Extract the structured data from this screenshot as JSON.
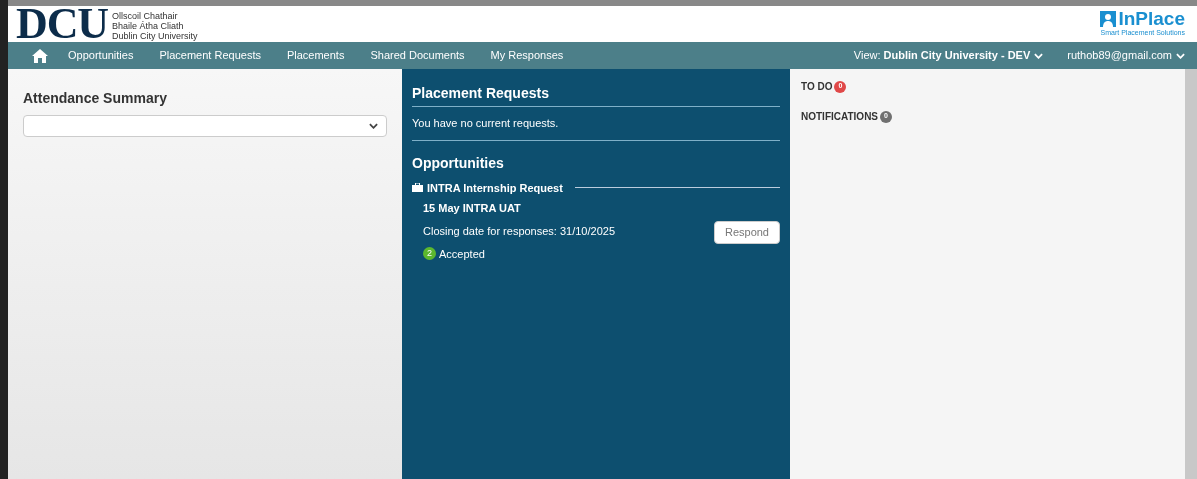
{
  "header": {
    "logo": "DCU",
    "university_lines": [
      "Ollscoil Chathair",
      "Bhaile Átha Cliath",
      "Dublin City University"
    ],
    "brand": "InPlace",
    "brand_tagline": "Smart Placement Solutions"
  },
  "nav": {
    "items": [
      "Opportunities",
      "Placement Requests",
      "Placements",
      "Shared Documents",
      "My Responses"
    ],
    "view_label": "View:",
    "view_value": "Dublin City University - DEV",
    "user": "ruthob89@gmail.com"
  },
  "attendance": {
    "title": "Attendance Summary"
  },
  "placement_requests": {
    "title": "Placement Requests",
    "message": "You have no current requests."
  },
  "opportunities": {
    "title": "Opportunities",
    "group": "INTRA Internship Request",
    "items": [
      {
        "name": "15 May INTRA UAT",
        "closing": "Closing date for responses: 31/10/2025",
        "button": "Respond",
        "count": "2",
        "status": "Accepted",
        "color": "#5cb82e"
      }
    ]
  },
  "sections": [
    {
      "label": "TO DO",
      "count": "0",
      "color": "#e04848"
    },
    {
      "label": "NOTIFICATIONS",
      "count": "0",
      "color": "#707070"
    }
  ]
}
